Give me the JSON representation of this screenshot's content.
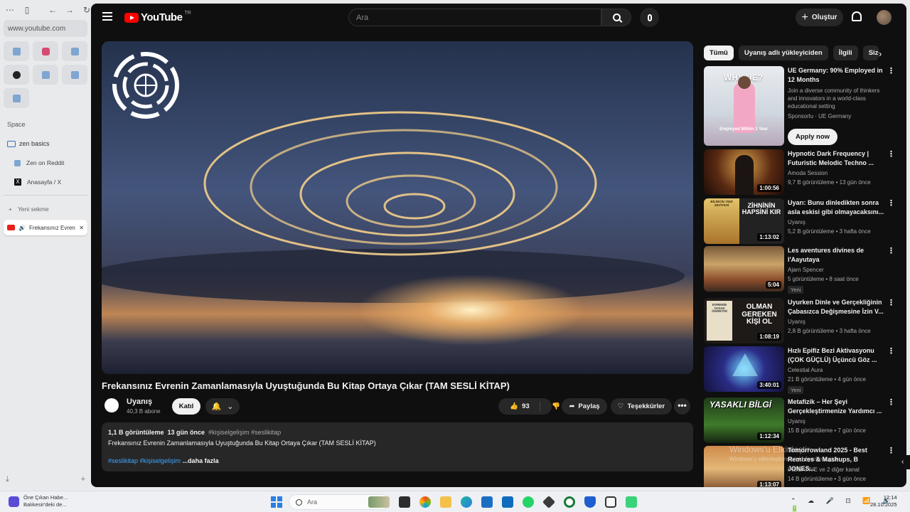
{
  "browser": {
    "url": "www.youtube.com",
    "space_label": "Space",
    "folder_label": "zen basics",
    "folder_items": [
      "Zen on Reddit",
      "Anasayfa / X"
    ],
    "new_tab_label": "Yeni sekme",
    "active_tab_label": "Frekansınız Evren"
  },
  "masthead": {
    "logo_text": "YouTube",
    "country_code": "TR",
    "search_placeholder": "Ara",
    "create_label": "Oluştur"
  },
  "video": {
    "title": "Frekansınız Evrenin Zamanlamasıyla Uyuştuğunda Bu Kitap Ortaya Çıkar (TAM SESLİ KİTAP)",
    "channel_name": "Uyanış",
    "subscribers": "40,3 B abone",
    "join_label": "Katıl",
    "likes": "93",
    "share_label": "Paylaş",
    "thanks_label": "Teşekkürler",
    "more_label": "•••"
  },
  "description": {
    "views": "1,1 B görüntüleme",
    "age": "13 gün önce",
    "header_tags": "#kişiselgelişim #seslikitap",
    "text": "Frekansınız Evrenin Zamanlamasıyla Uyuştuğunda Bu Kitap Ortaya Çıkar (TAM SESLİ KİTAP)",
    "tags": "#seslikitap #kişiselgelişim",
    "more_label": "...daha fazla"
  },
  "chips": [
    "Tümü",
    "Uyanış adlı yükleyiciden",
    "İlgili",
    "Size"
  ],
  "recommendations": [
    {
      "title": "UE Germany: 90% Employed in 12 Months",
      "line2": "Join a diverse community of thinkers and innovators in a world-class educational setting",
      "channel": "Sponsorlu · UE Germany",
      "cta": "Apply now",
      "thumb_text_top": "WHY UE?",
      "thumb_text_bottom": "Employed Within 1 Year"
    },
    {
      "title": "Hypnotic Dark Frequency | Futuristic Melodic Techno ...",
      "channel": "Amoda Session",
      "meta": "9,7 B görüntüleme • 13 gün önce",
      "duration": "1:00:56"
    },
    {
      "title": "Uyarı: Bunu dinledikten sonra asla eskisi gibi olmayacaksını...",
      "channel": "Uyanış",
      "meta": "5,2 B görüntüleme • 3 hafta önce",
      "duration": "1:13:02",
      "thumb_text_left": "BİLİNCİN YEDİ SEVİYESİ",
      "thumb_text_right": "ZİHNİNİN HAPSİNİ KIR"
    },
    {
      "title": "Les aventures divines de l'Aayutaya",
      "channel": "Ajarn Spencer",
      "meta": "5 görüntüleme • 8 saat önce",
      "duration": "5:04",
      "badge": "Yeni"
    },
    {
      "title": "Uyurken Dinle ve Gerçekliğinin Çabasızca Değişmesine İzin V...",
      "channel": "Uyanış",
      "meta": "2,8 B görüntüleme • 3 hafta önce",
      "duration": "1:08:19",
      "thumb_text_left": "EVRENİN YASAK ÖĞRETİSİ",
      "thumb_text_right": "OLMAN GEREKEN KİŞİ OL"
    },
    {
      "title": "Hızlı Epifiz Bezi Aktivasyonu (ÇOK GÜÇLÜ) Üçüncü Göz ...",
      "channel": "Celestial Aura",
      "meta": "21 B görüntüleme • 4 gün önce",
      "duration": "3:40:01",
      "badge": "Yeni"
    },
    {
      "title": "Metafizik – Her Şeyi Gerçekleştirmenize Yardımcı ...",
      "channel": "Uyanış",
      "meta": "15 B görüntüleme • 7 gün önce",
      "duration": "1:12:34",
      "thumb_text_top": "YASAKLI BİLGİ"
    },
    {
      "title": "Tomorrowland 2025 - Best Remixes & Mashups, B JONES...",
      "channel": "INEGATIVE ve 2 diğer kanal",
      "meta": "14 B görüntüleme • 3 gün önce",
      "duration": "1:13:07"
    }
  ],
  "watermark": {
    "line1": "Windows'u Etkinleştir",
    "line2": "Windows'u etkinleştirmek için Ayarlar'a gidin."
  },
  "taskbar": {
    "weather_title": "Öne Çıkan Habe...",
    "weather_sub": "Balıkesir'deki de...",
    "search_placeholder": "Ara",
    "time": "12:14",
    "date": "28.10.2025"
  }
}
